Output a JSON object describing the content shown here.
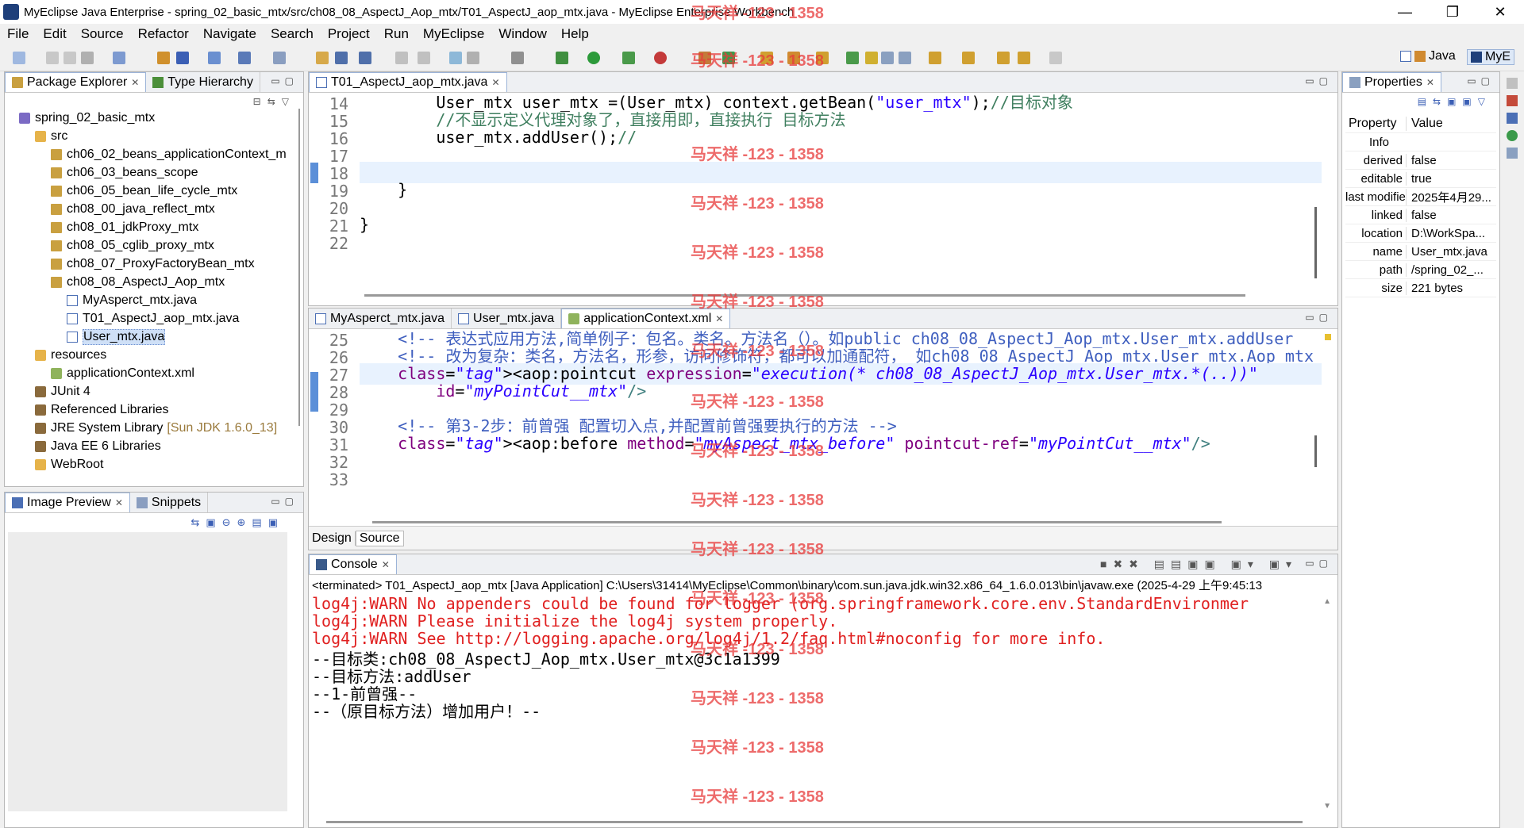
{
  "window": {
    "title": "MyEclipse Java Enterprise - spring_02_basic_mtx/src/ch08_08_AspectJ_Aop_mtx/T01_AspectJ_aop_mtx.java - MyEclipse Enterprise Workbench",
    "minimize": "—",
    "maximize": "❐",
    "close": "✕"
  },
  "menu": [
    "File",
    "Edit",
    "Source",
    "Refactor",
    "Navigate",
    "Search",
    "Project",
    "Run",
    "MyEclipse",
    "Window",
    "Help"
  ],
  "perspectives": {
    "java": "Java",
    "myeclipse": "MyE"
  },
  "package_explorer": {
    "tabs": [
      "Package Explorer",
      "Type Hierarchy"
    ],
    "tree": [
      {
        "label": "spring_02_basic_mtx",
        "type": "proj",
        "depth": 0
      },
      {
        "label": "src",
        "type": "folder",
        "depth": 1
      },
      {
        "label": "ch06_02_beans_applicationContext_m",
        "type": "pkg",
        "depth": 2
      },
      {
        "label": "ch06_03_beans_scope",
        "type": "pkg",
        "depth": 2
      },
      {
        "label": "ch06_05_bean_life_cycle_mtx",
        "type": "pkg",
        "depth": 2
      },
      {
        "label": "ch08_00_java_reflect_mtx",
        "type": "pkg",
        "depth": 2
      },
      {
        "label": "ch08_01_jdkProxy_mtx",
        "type": "pkg",
        "depth": 2
      },
      {
        "label": "ch08_05_cglib_proxy_mtx",
        "type": "pkg",
        "depth": 2
      },
      {
        "label": "ch08_07_ProxyFactoryBean_mtx",
        "type": "pkg",
        "depth": 2
      },
      {
        "label": "ch08_08_AspectJ_Aop_mtx",
        "type": "pkg",
        "depth": 2
      },
      {
        "label": "MyAsperct_mtx.java",
        "type": "java",
        "depth": 3
      },
      {
        "label": "T01_AspectJ_aop_mtx.java",
        "type": "java",
        "depth": 3
      },
      {
        "label": "User_mtx.java",
        "type": "java",
        "depth": 3,
        "selected": true
      },
      {
        "label": "resources",
        "type": "folder",
        "depth": 1
      },
      {
        "label": "applicationContext.xml",
        "type": "xml",
        "depth": 2
      },
      {
        "label": "JUnit 4",
        "type": "lib",
        "depth": 1
      },
      {
        "label": "Referenced Libraries",
        "type": "lib",
        "depth": 1
      },
      {
        "label": "JRE System Library",
        "type": "lib",
        "depth": 1,
        "suffix": "[Sun JDK 1.6.0_13]"
      },
      {
        "label": "Java EE 6 Libraries",
        "type": "lib",
        "depth": 1
      },
      {
        "label": "WebRoot",
        "type": "folder",
        "depth": 1
      }
    ]
  },
  "image_preview": {
    "tabs": [
      "Image Preview",
      "Snippets"
    ]
  },
  "editor_top": {
    "tab": "T01_AspectJ_aop_mtx.java",
    "lines": [
      {
        "n": "14",
        "code": "        User_mtx user_mtx =(User_mtx) context.getBean(\"user_mtx\");//目标对象"
      },
      {
        "n": "15",
        "code": "        //不显示定义代理对象了，直接用即，直接执行 目标方法"
      },
      {
        "n": "16",
        "code": "        user_mtx.addUser();//"
      },
      {
        "n": "17",
        "code": ""
      },
      {
        "n": "18",
        "code": ""
      },
      {
        "n": "19",
        "code": "    }"
      },
      {
        "n": "20",
        "code": ""
      },
      {
        "n": "21",
        "code": "}"
      },
      {
        "n": "22",
        "code": ""
      }
    ]
  },
  "editor_bottom": {
    "tabs": [
      "MyAsperct_mtx.java",
      "User_mtx.java",
      "applicationContext.xml"
    ],
    "lines": [
      {
        "n": "25",
        "code": "    <!-- 表达式应用方法,简单例子：包名。类名。方法名（）。如public ch08_08_AspectJ_Aop_mtx.User_mtx.addUser"
      },
      {
        "n": "26",
        "code": "    <!-- 改为复杂：类名，方法名，形参，访问修饰符，都可以加通配符， 如ch08_08_AspectJ_Aop_mtx.User_mtx.Aop_mtx"
      },
      {
        "n": "27",
        "code": "    <aop:pointcut expression=\"execution(* ch08_08_AspectJ_Aop_mtx.User_mtx.*(..))\""
      },
      {
        "n": "28",
        "code": "        id=\"myPointCut__mtx\"/>"
      },
      {
        "n": "29",
        "code": ""
      },
      {
        "n": "30",
        "code": "    <!-- 第3-2步：前曾强 配置切入点,并配置前曾强要执行的方法 -->"
      },
      {
        "n": "31",
        "code": "    <aop:before method=\"myAspect_mtx_before\" pointcut-ref=\"myPointCut__mtx\"/>"
      },
      {
        "n": "32",
        "code": ""
      },
      {
        "n": "33",
        "code": ""
      }
    ],
    "bottom_tabs": [
      "Design",
      "Source"
    ]
  },
  "properties": {
    "tab": "Properties",
    "headers": [
      "Property",
      "Value"
    ],
    "group": "Info",
    "rows": [
      {
        "k": "derived",
        "v": "false"
      },
      {
        "k": "editable",
        "v": "true"
      },
      {
        "k": "last modified",
        "v": "2025年4月29..."
      },
      {
        "k": "linked",
        "v": "false"
      },
      {
        "k": "location",
        "v": "D:\\WorkSpa..."
      },
      {
        "k": "name",
        "v": "User_mtx.java"
      },
      {
        "k": "path",
        "v": "/spring_02_..."
      },
      {
        "k": "size",
        "v": "221  bytes"
      }
    ]
  },
  "console": {
    "tab": "Console",
    "header": "<terminated> T01_AspectJ_aop_mtx [Java Application] C:\\Users\\31414\\MyEclipse\\Common\\binary\\com.sun.java.jdk.win32.x86_64_1.6.0.013\\bin\\javaw.exe (2025-4-29 上午9:45:13",
    "lines": [
      {
        "text": "log4j:WARN No appenders could be found for logger (org.springframework.core.env.StandardEnvironmer",
        "err": true
      },
      {
        "text": "log4j:WARN Please initialize the log4j system properly.",
        "err": true
      },
      {
        "text": "log4j:WARN See http://logging.apache.org/log4j/1.2/faq.html#noconfig for more info.",
        "err": true
      },
      {
        "text": "--目标类:ch08_08_AspectJ_Aop_mtx.User_mtx@3c1a1399",
        "err": false
      },
      {
        "text": "--目标方法:addUser",
        "err": false
      },
      {
        "text": "--1-前曾强--",
        "err": false
      },
      {
        "text": "--（原目标方法）增加用户！--",
        "err": false
      }
    ]
  },
  "watermark": "马天祥 -123 - 1358"
}
